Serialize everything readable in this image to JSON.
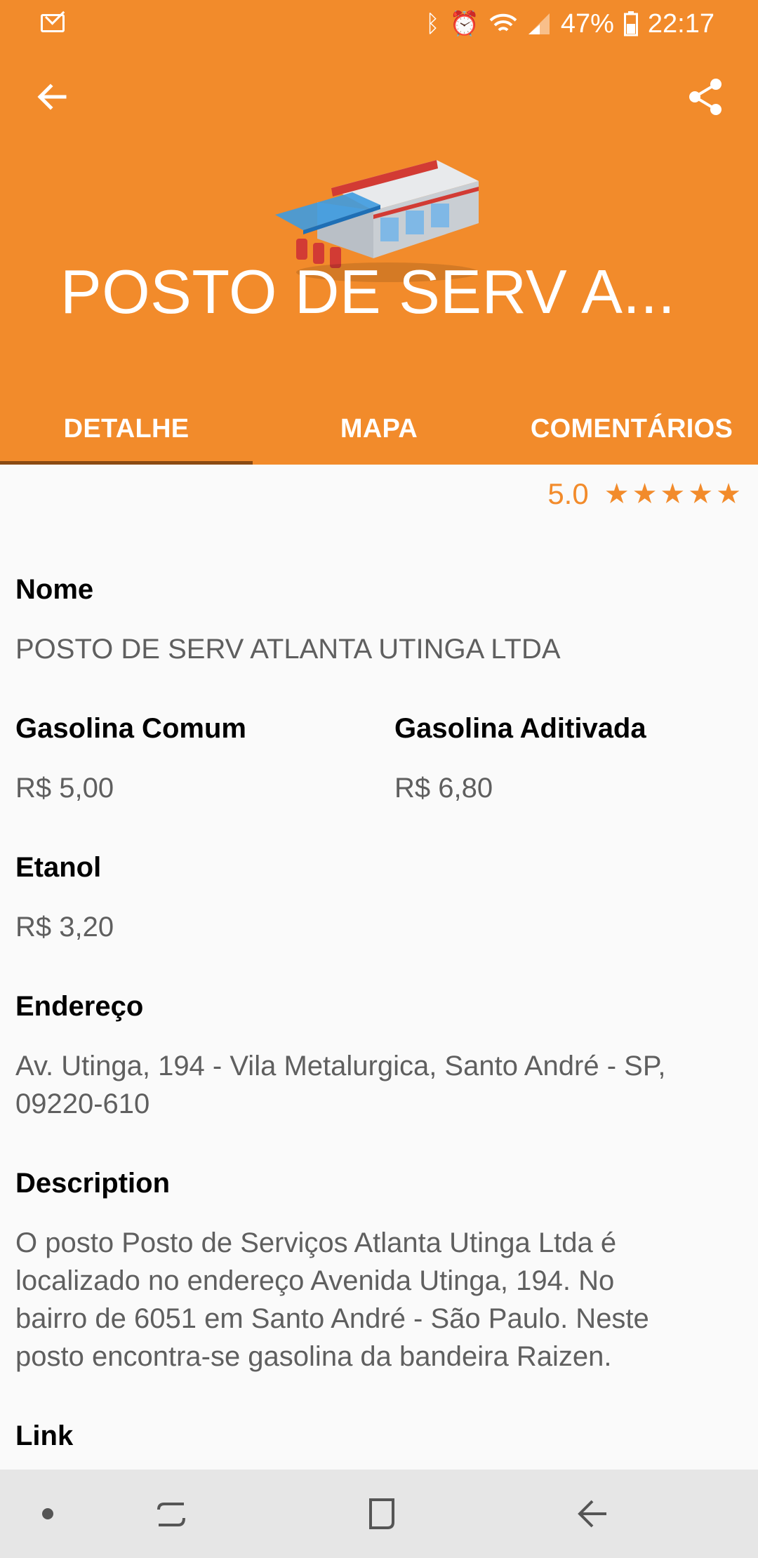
{
  "status_bar": {
    "battery": "47%",
    "time": "22:17"
  },
  "icons": {
    "back": "back-arrow-icon",
    "share": "share-icon",
    "mail": "mail-icon",
    "star": "star-icon"
  },
  "colors": {
    "primary": "#f28b2b",
    "tab_indicator": "#8a4a12",
    "background": "#fafafa"
  },
  "header": {
    "title": "POSTO DE SERV A..."
  },
  "tabs": [
    {
      "label": "DETALHE",
      "selected": true
    },
    {
      "label": "MAPA",
      "selected": false
    },
    {
      "label": "COMENTÁRIOS",
      "selected": false
    }
  ],
  "rating": {
    "value": "5.0",
    "stars": 5
  },
  "details": {
    "name_label": "Nome",
    "name_value": "POSTO DE SERV ATLANTA UTINGA LTDA",
    "gas_common_label": "Gasolina Comum",
    "gas_common_value": "R$ 5,00",
    "gas_additive_label": "Gasolina Aditivada",
    "gas_additive_value": "R$ 6,80",
    "ethanol_label": "Etanol",
    "ethanol_value": "R$ 3,20",
    "address_label": "Endereço",
    "address_line1": "Av. Utinga, 194 - Vila Metalurgica, Santo André - SP,",
    "address_line2": "09220-610",
    "description_label": "Description",
    "description_lines": [
      "O posto Posto de Serviços Atlanta Utinga Ltda é",
      "localizado no endereço Avenida Utinga, 194. No",
      "bairro de 6051 em Santo André - São Paulo. Neste",
      "posto encontra-se gasolina da bandeira Raizen."
    ],
    "link_label": "Link"
  }
}
